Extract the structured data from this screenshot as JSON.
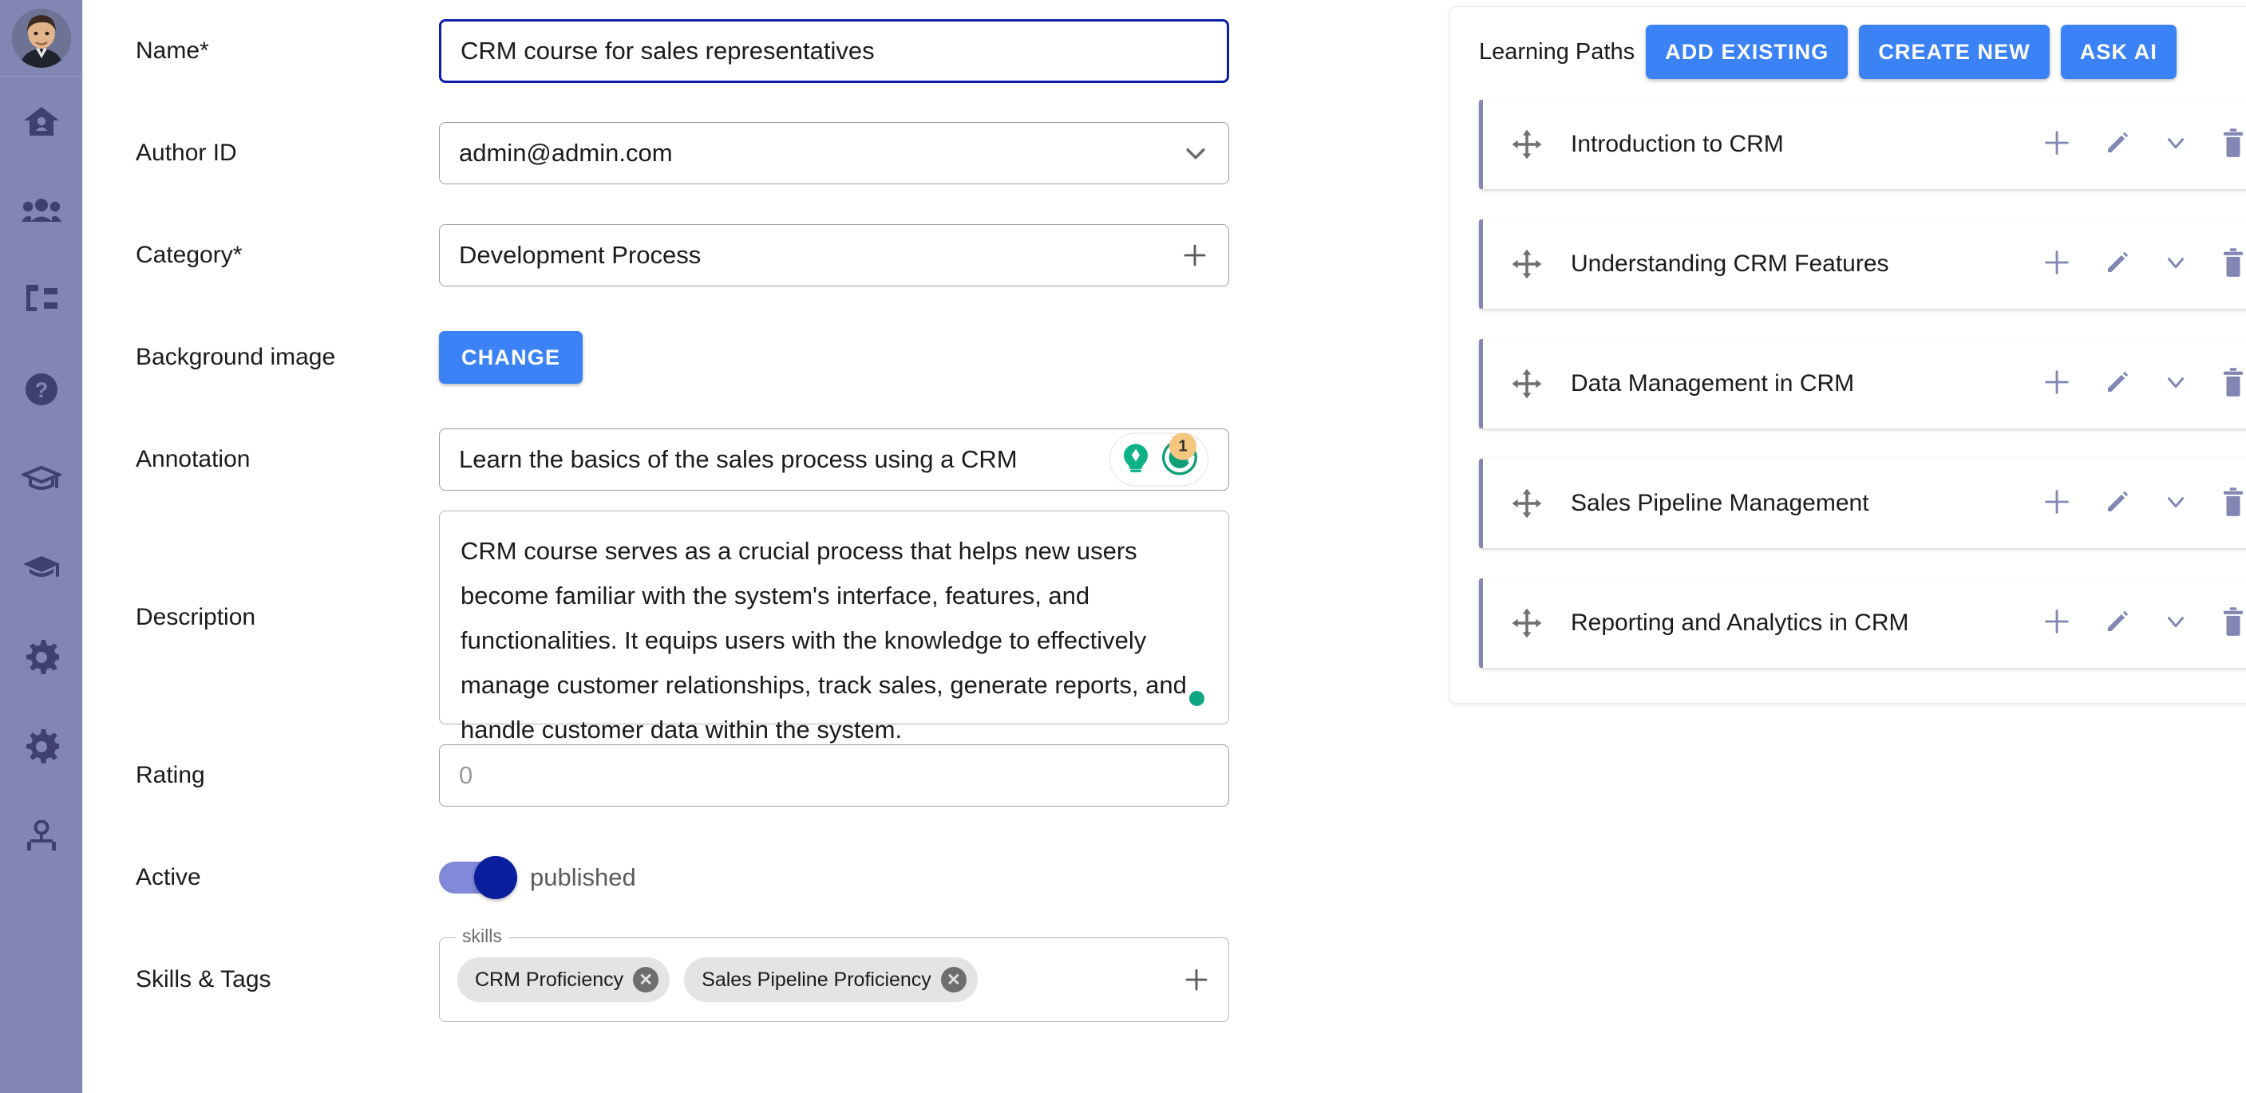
{
  "sidebar": {
    "avatar_name": "user-avatar",
    "items": [
      {
        "icon": "home-icon",
        "label": "Home"
      },
      {
        "icon": "people-icon",
        "label": "Users"
      },
      {
        "icon": "org-tree-icon",
        "label": "Structure"
      },
      {
        "icon": "help-icon",
        "label": "Help"
      },
      {
        "icon": "graduation-outline-icon",
        "label": "Courses"
      },
      {
        "icon": "graduation-filled-icon",
        "label": "Learning"
      },
      {
        "icon": "gear-icon",
        "label": "Settings"
      },
      {
        "icon": "gear-alt-icon",
        "label": "Admin Settings"
      },
      {
        "icon": "user-manager-icon",
        "label": "Profile"
      }
    ]
  },
  "form": {
    "name": {
      "label": "Name*",
      "value": "CRM course for sales representatives",
      "focused": true
    },
    "author_id": {
      "label": "Author ID",
      "value": "admin@admin.com",
      "icon": "chevron-down-icon"
    },
    "category": {
      "label": "Category*",
      "value": "Development Process",
      "icon": "plus-icon"
    },
    "background_image": {
      "label": "Background image",
      "button_label": "CHANGE"
    },
    "annotation": {
      "label": "Annotation",
      "value": "Learn the basics of the sales process using a CRM",
      "assistant_badge_count": "1",
      "assistant_icons": [
        "grammarly-lightbulb-icon",
        "grammarly-g-icon"
      ]
    },
    "description": {
      "label": "Description",
      "value": "CRM course serves as a crucial process that helps new users become familiar with the system's interface, features, and functionalities. It equips users with the knowledge to effectively manage customer relationships, track sales, generate reports, and handle customer data within the system.",
      "status_dot_color": "#11a683"
    },
    "rating": {
      "label": "Rating",
      "value": "",
      "placeholder": "0"
    },
    "active": {
      "label": "Active",
      "state_label": "published",
      "checked": true
    },
    "skills_tags": {
      "label": "Skills & Tags",
      "legend": "skills",
      "chips": [
        "CRM Proficiency",
        "Sales Pipeline Proficiency"
      ],
      "add_icon": "plus-icon"
    }
  },
  "learning_paths": {
    "title": "Learning Paths",
    "buttons": [
      {
        "label": "ADD EXISTING"
      },
      {
        "label": "CREATE NEW"
      },
      {
        "label": "ASK AI"
      }
    ],
    "row_actions": [
      "plus-icon",
      "edit-pencil-icon",
      "chevron-down-icon",
      "trash-icon"
    ],
    "items": [
      {
        "name": "Introduction to CRM"
      },
      {
        "name": "Understanding CRM Features"
      },
      {
        "name": "Data Management in CRM"
      },
      {
        "name": "Sales Pipeline Management"
      },
      {
        "name": "Reporting and Analytics in CRM"
      }
    ]
  },
  "colors": {
    "sidebar_bg": "#8186b3",
    "sidebar_icon": "#3f3f70",
    "primary_blue": "#3b82f6",
    "focus_blue": "#0d1fa8",
    "accent_purple": "#8186b3",
    "grammarly_green": "#11a683",
    "badge_orange": "#f5c77e"
  }
}
